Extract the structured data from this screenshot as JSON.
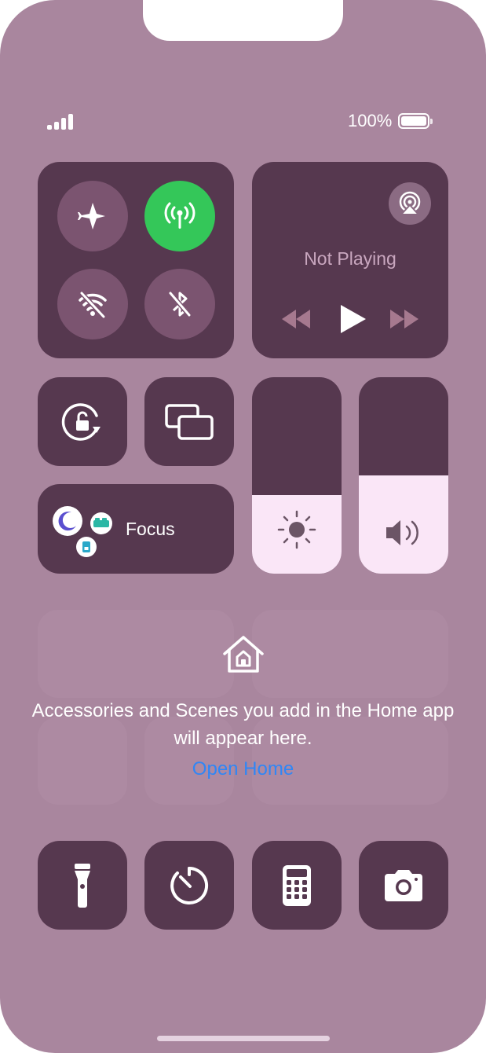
{
  "status_bar": {
    "battery_text": "100%",
    "signal_icon": "cellular-signal-icon",
    "battery_icon": "battery-full-icon"
  },
  "connectivity": {
    "airplane": {
      "icon": "airplane-icon",
      "on": false
    },
    "cellular": {
      "icon": "cellular-antenna-icon",
      "on": true,
      "color": "#34c759"
    },
    "wifi": {
      "icon": "wifi-off-icon",
      "on": false
    },
    "bluetooth": {
      "icon": "bluetooth-off-icon",
      "on": false
    }
  },
  "now_playing": {
    "title": "Not Playing",
    "airplay_icon": "airplay-audio-icon",
    "controls": [
      "rewind-icon",
      "play-icon",
      "fast-forward-icon"
    ]
  },
  "focus": {
    "label": "Focus",
    "icons": [
      "moon-icon",
      "bed-icon",
      "work-badge-icon"
    ]
  },
  "brightness": {
    "icon": "sun-icon",
    "level": 0.4
  },
  "volume": {
    "icon": "speaker-icon",
    "level": 0.5
  },
  "home": {
    "message": "Accessories and Scenes you add in the Home app will appear here.",
    "link": "Open Home",
    "link_color": "#2f86f6"
  },
  "bottom_row": [
    "flashlight-icon",
    "timer-icon",
    "calculator-icon",
    "camera-icon"
  ],
  "colors": {
    "background": "#a9869e",
    "tile": "#56384f",
    "circle": "#7b5470",
    "slider_fill": "#fae6f7"
  }
}
